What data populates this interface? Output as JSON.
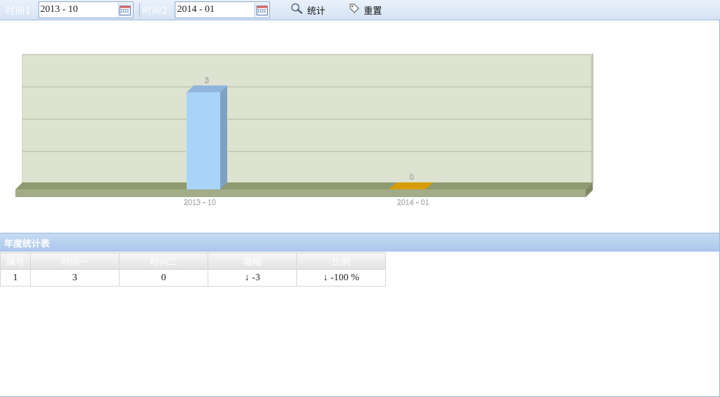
{
  "toolbar": {
    "time1_label": "时间1:",
    "time1_value": "2013 - 10",
    "time2_label": "时间2:",
    "time2_value": "2014 - 01",
    "stat_label": "统计",
    "reset_label": "重置",
    "calendar_icon": "calendar-icon",
    "search_icon": "magnifier-icon",
    "reset_icon": "tag-icon"
  },
  "chart_data": {
    "type": "bar",
    "title": "",
    "categories": [
      "2013 - 10",
      "2014 - 01"
    ],
    "values": [
      3,
      0
    ],
    "value_labels": [
      "3",
      "0"
    ],
    "ylim": [
      0,
      4
    ],
    "yticks": [
      "0",
      "1",
      "2",
      "3",
      "4"
    ],
    "grid": true,
    "colors": {
      "bar1": "#a9d4fa",
      "bar2": "#d79c00",
      "plot_bg": "#dde2d1",
      "floor": "#a2ac87"
    }
  },
  "table": {
    "title": "年度统计表",
    "headers": [
      "编号",
      "时间一",
      "时间二",
      "增幅",
      "比例"
    ],
    "rows": [
      [
        "1",
        "3",
        "0",
        "↓ -3",
        "↓ -100 %"
      ]
    ]
  }
}
